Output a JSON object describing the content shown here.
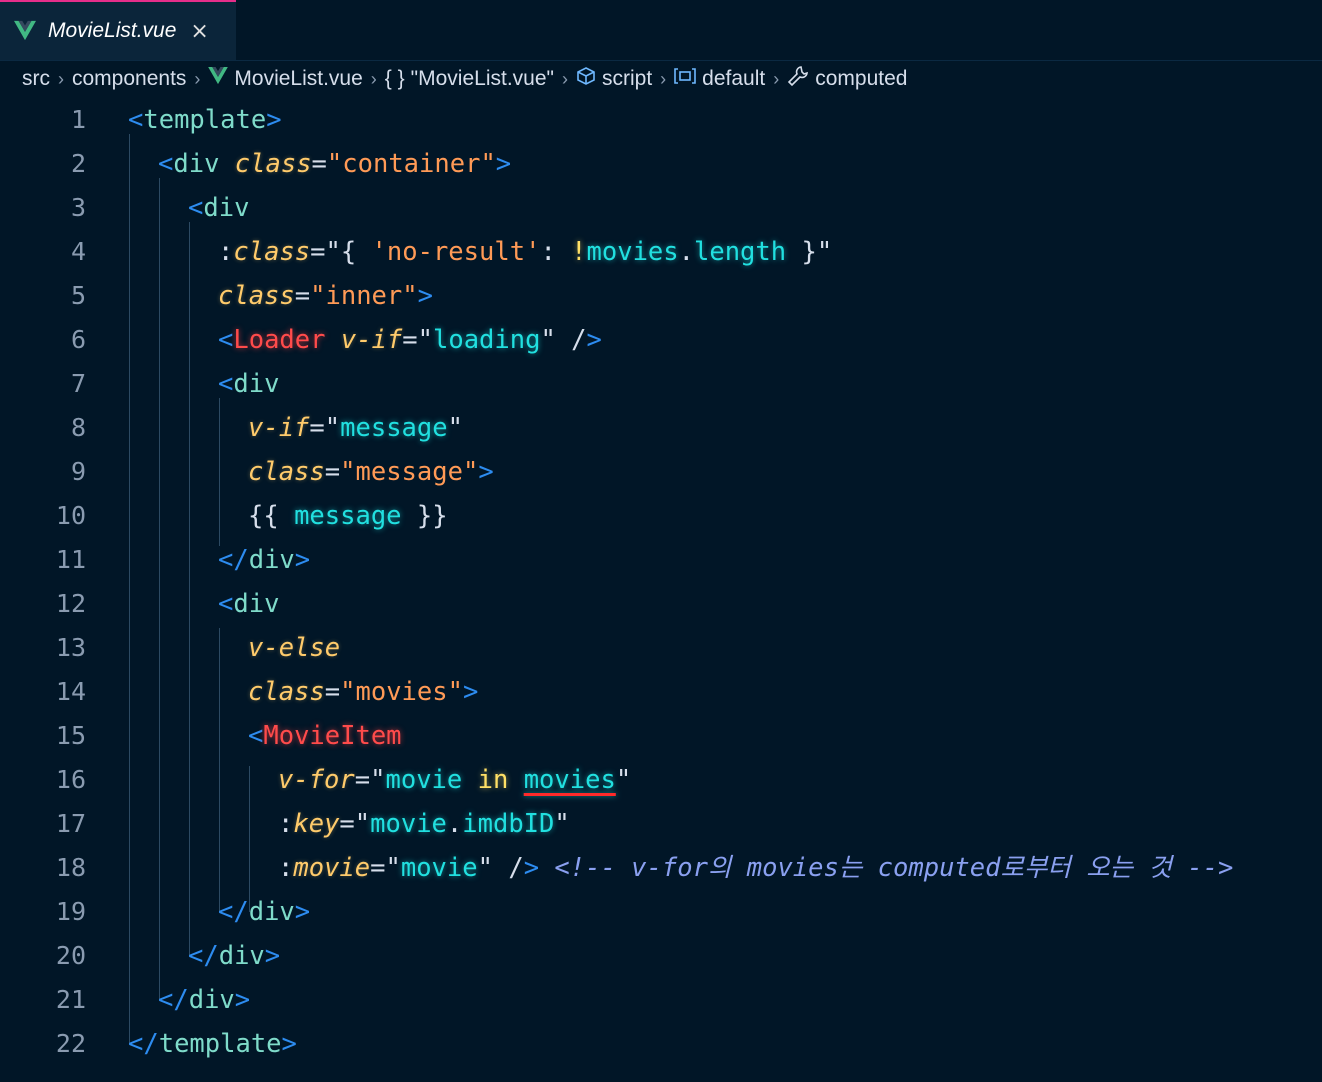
{
  "tab": {
    "filename": "MovieList.vue",
    "close_glyph": "×",
    "icon": "vue-logo-icon"
  },
  "breadcrumb": [
    "src",
    "components",
    "MovieList.vue",
    "\"MovieList.vue\"",
    "script",
    "default",
    "computed"
  ],
  "colors": {
    "background": "#011627",
    "tab_active_border": "#e62e8a",
    "bracket": "#2d8cf0",
    "tag": "#7fdbca",
    "component": "#ff4b4b",
    "attribute": "#ffcb6b",
    "string": "#ff9a56",
    "js_expr": "#21e0e0",
    "comment": "#8aa0f0"
  },
  "lines": [
    {
      "n": "1"
    },
    {
      "n": "2"
    },
    {
      "n": "3"
    },
    {
      "n": "4"
    },
    {
      "n": "5"
    },
    {
      "n": "6"
    },
    {
      "n": "7"
    },
    {
      "n": "8"
    },
    {
      "n": "9"
    },
    {
      "n": "10"
    },
    {
      "n": "11"
    },
    {
      "n": "12"
    },
    {
      "n": "13"
    },
    {
      "n": "14"
    },
    {
      "n": "15"
    },
    {
      "n": "16"
    },
    {
      "n": "17"
    },
    {
      "n": "18"
    },
    {
      "n": "19"
    },
    {
      "n": "20"
    },
    {
      "n": "21"
    },
    {
      "n": "22"
    }
  ],
  "tokens": {
    "template": "template",
    "div": "div",
    "class_attr": "class",
    "container": "container",
    "no_result_key": "'no-result'",
    "not_op": "!",
    "movies": "movies",
    "length": "length",
    "inner": "inner",
    "loader": "Loader",
    "v_if": "v-if",
    "loading": "loading",
    "message": "message",
    "v_else": "v-else",
    "movies_class": "movies",
    "movie_item": "MovieItem",
    "v_for": "v-for",
    "movie": "movie",
    "in_kw": "in",
    "key_attr": "key",
    "imdb_id": "imdbID",
    "movie_prop": "movie",
    "comment": "<!-- v-for의 movies는 computed로부터 오는 것 -->"
  }
}
